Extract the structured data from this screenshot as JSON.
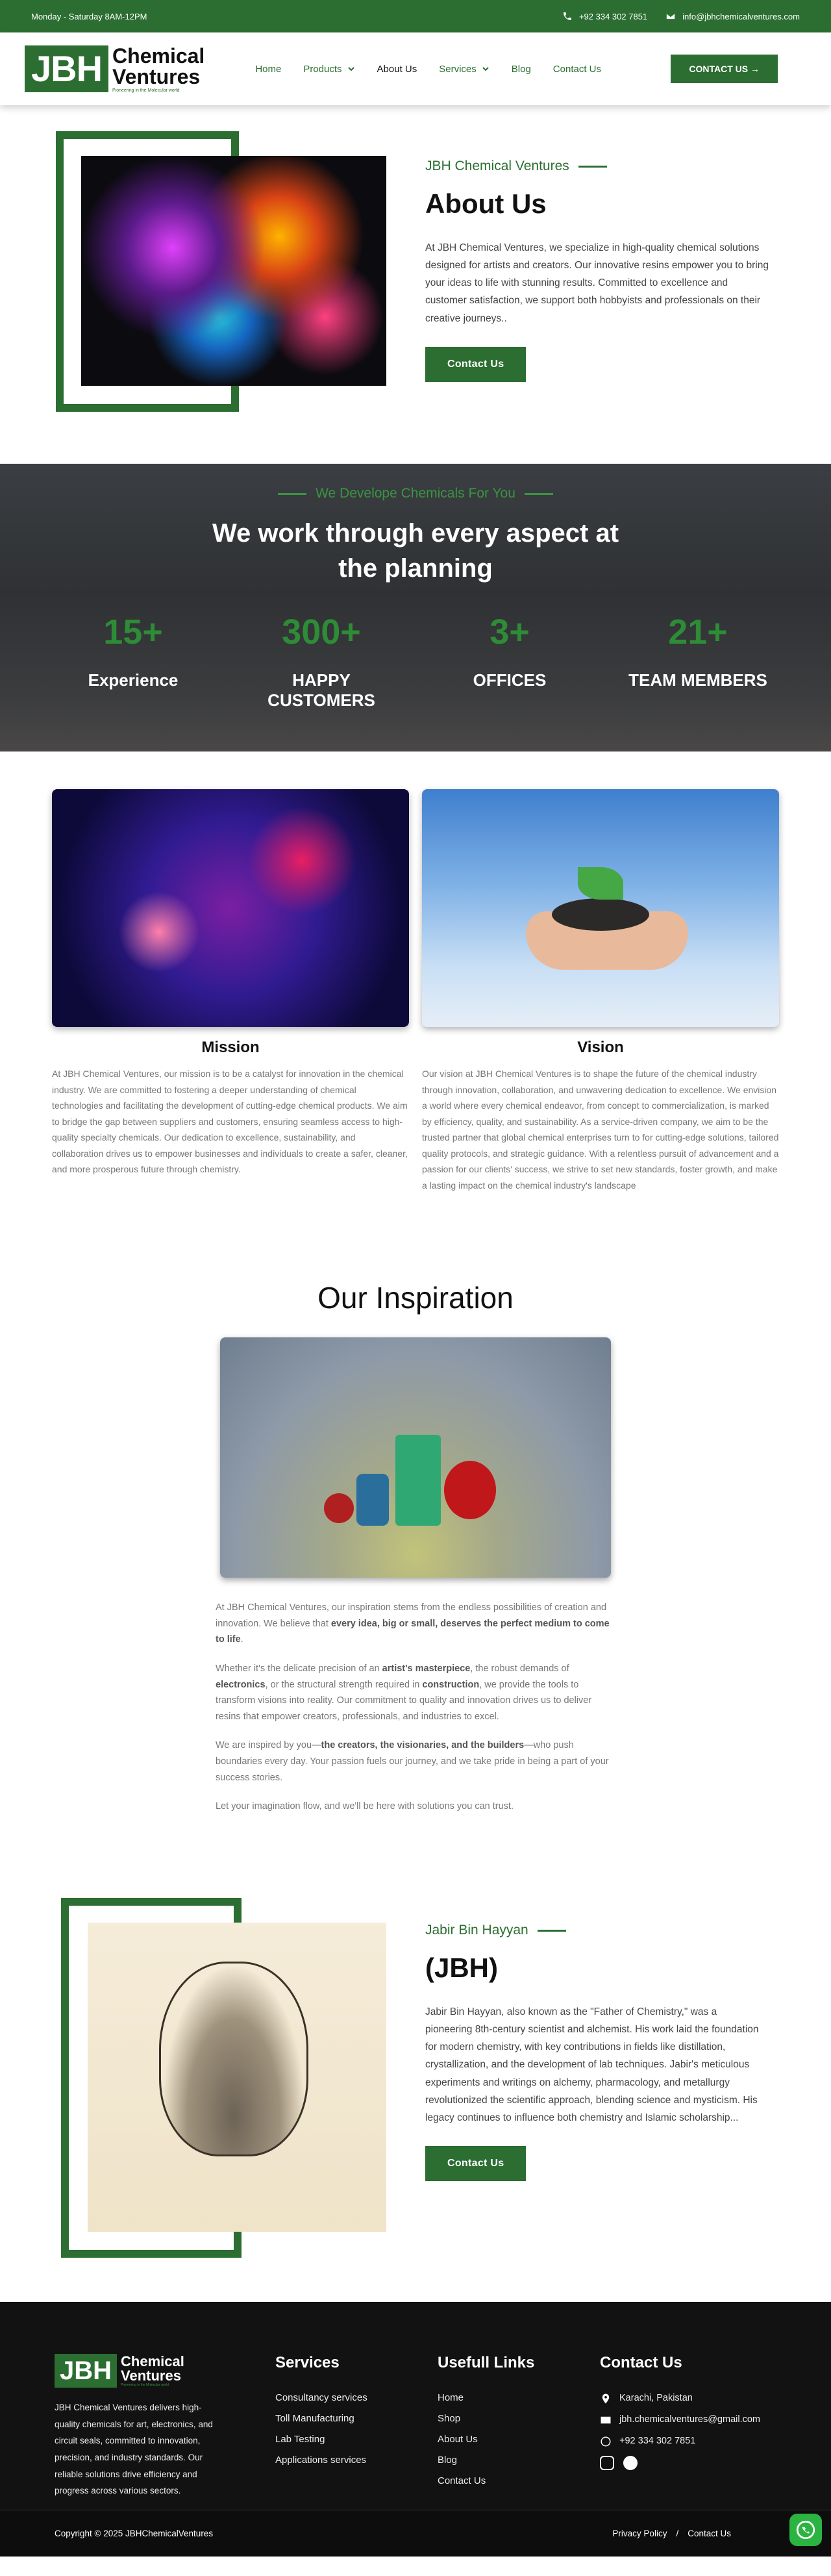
{
  "topbar": {
    "hours": "Monday - Saturday 8AM-12PM",
    "phone": "+92 334 302 7851",
    "email": "info@jbhchemicalventures.com"
  },
  "brand": {
    "logo_mark": "JBH",
    "name_line1": "Chemical",
    "name_line2": "Ventures",
    "tagline": "Pioneering in the Molecular world",
    "color": "#2c6e32"
  },
  "nav": {
    "items": [
      {
        "label": "Home",
        "dropdown": false
      },
      {
        "label": "Products",
        "dropdown": true
      },
      {
        "label": "About Us",
        "dropdown": false,
        "active": true
      },
      {
        "label": "Services",
        "dropdown": true
      },
      {
        "label": "Blog",
        "dropdown": false
      },
      {
        "label": "Contact Us",
        "dropdown": false
      }
    ],
    "cta": "CONTACT US →"
  },
  "about": {
    "subtitle": "JBH Chemical Ventures",
    "title": "About Us",
    "text": "At JBH Chemical Ventures, we specialize in high-quality chemical solutions designed for artists and creators. Our innovative resins empower you to bring your ideas to life with stunning results. Committed to excellence and customer satisfaction, we support both hobbyists and professionals on their creative journeys..",
    "button": "Contact Us"
  },
  "stats": {
    "subtitle": "We Develope Chemicals For You",
    "title_line1": "We work through every aspect at",
    "title_line2": "the planning",
    "items": [
      {
        "number": "15+",
        "label": "Experience"
      },
      {
        "number": "300+",
        "label": "HAPPY CUSTOMERS"
      },
      {
        "number": "3+",
        "label": "OFFICES"
      },
      {
        "number": "21+",
        "label": "TEAM MEMBERS"
      }
    ]
  },
  "mission": {
    "title": "Mission",
    "text": "At JBH Chemical Ventures, our mission is to be a catalyst for innovation in the chemical industry. We are committed to fostering a deeper understanding of chemical technologies and facilitating the development of cutting-edge chemical products. We aim to bridge the gap between suppliers and customers, ensuring seamless access to high-quality specialty chemicals. Our dedication to excellence, sustainability, and collaboration drives us to empower businesses and individuals to create a safer, cleaner, and more prosperous future through chemistry."
  },
  "vision": {
    "title": "Vision",
    "text": "Our vision at JBH Chemical Ventures is to shape the future of the chemical industry through innovation, collaboration, and unwavering dedication to excellence. We envision a world where every chemical endeavor, from concept to commercialization, is marked by efficiency, quality, and sustainability. As a service-driven company, we aim to be the trusted partner that global chemical enterprises turn to for cutting-edge solutions, tailored quality protocols, and strategic guidance. With a relentless pursuit of advancement and a passion for our clients' success, we strive to set new standards, foster growth, and make a lasting impact on the chemical industry's landscape"
  },
  "inspiration": {
    "title": "Our Inspiration",
    "p1_a": "At JBH Chemical Ventures, our inspiration stems from the endless possibilities of creation and innovation. We believe that ",
    "p1_b": "every idea, big or small, deserves the perfect medium to come to life",
    "p1_c": ".",
    "p2_a": "Whether it's the delicate precision of an ",
    "p2_b": "artist's masterpiece",
    "p2_c": ", the robust demands of ",
    "p2_d": "electronics",
    "p2_e": ", or the structural strength required in ",
    "p2_f": "construction",
    "p2_g": ", we provide the tools to transform visions into reality. Our commitment to quality and innovation drives us to deliver resins that empower creators, professionals, and industries to excel.",
    "p3_a": "We are inspired by you—",
    "p3_b": "the creators, the visionaries, and the builders",
    "p3_c": "—who push boundaries every day. Your passion fuels our journey, and we take pride in being a part of your success stories.",
    "p4": "Let your imagination flow, and we'll be here with solutions you can trust."
  },
  "jabir": {
    "subtitle": "Jabir Bin Hayyan",
    "title": "(JBH)",
    "text": "Jabir Bin Hayyan, also known as the \"Father of Chemistry,\" was a pioneering 8th-century scientist and alchemist. His work laid the foundation for modern chemistry, with key contributions in fields like distillation, crystallization, and the development of lab techniques. Jabir's meticulous experiments and writings on alchemy, pharmacology, and metallurgy revolutionized the scientific approach, blending science and mysticism. His legacy continues to influence both chemistry and Islamic scholarship...",
    "button": "Contact Us"
  },
  "footer": {
    "description": "JBH Chemical Ventures delivers high-quality chemicals for art, electronics, and circuit seals, committed to innovation, precision, and industry standards. Our reliable solutions drive efficiency and progress across various sectors.",
    "services_title": "Services",
    "services": [
      "Consultancy services",
      "Toll Manufacturing",
      "Lab Testing",
      "Applications services"
    ],
    "links_title": "Usefull Links",
    "links": [
      "Home",
      "Shop",
      "About Us",
      "Blog",
      "Contact Us"
    ],
    "contact_title": "Contact Us",
    "address": "Karachi, Pakistan",
    "email": "jbh.chemicalventures@gmail.com",
    "phone": "+92 334 302 7851",
    "copyright": "Copyright © 2025 JBHChemicalVentures",
    "privacy": "Privacy Policy",
    "separator": "/",
    "contact_link": "Contact Us"
  }
}
